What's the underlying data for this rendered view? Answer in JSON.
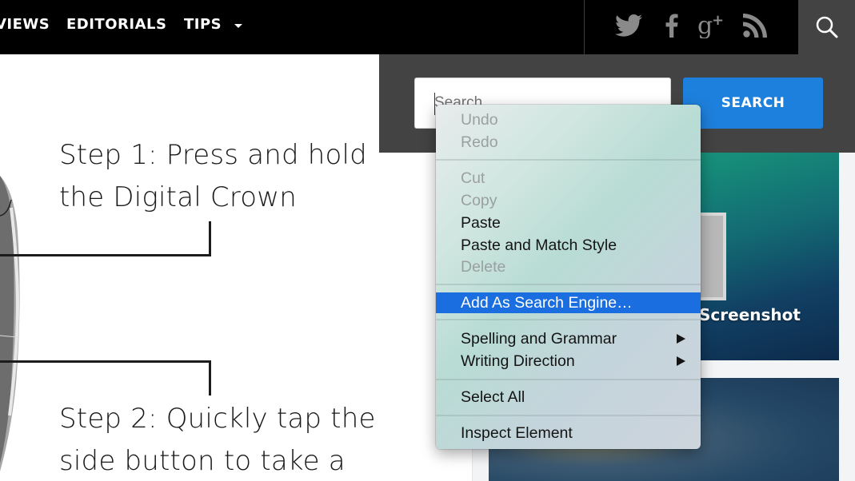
{
  "nav": {
    "items": [
      {
        "label": "VIEWS"
      },
      {
        "label": "EDITORIALS"
      },
      {
        "label": "TIPS"
      }
    ],
    "social": [
      "twitter-icon",
      "facebook-icon",
      "google-plus-icon",
      "rss-icon"
    ],
    "search_toggle_icon": "search-icon"
  },
  "search": {
    "placeholder": "Search",
    "button_label": "SEARCH",
    "button_color": "#1e80dd"
  },
  "article": {
    "step1_line1": "Step 1: Press and hold",
    "step1_line2": "the Digital Crown",
    "step2_line1": "Step 2: Quickly tap the",
    "step2_line2": "side button to take a"
  },
  "sidebar": {
    "thumb1_title": "Screenshot"
  },
  "context_menu": {
    "items": [
      {
        "label": "Undo",
        "enabled": false
      },
      {
        "label": "Redo",
        "enabled": false
      },
      {
        "label": "Cut",
        "enabled": false
      },
      {
        "label": "Copy",
        "enabled": false
      },
      {
        "label": "Paste",
        "enabled": true
      },
      {
        "label": "Paste and Match Style",
        "enabled": true
      },
      {
        "label": "Delete",
        "enabled": false
      },
      {
        "label": "Add As Search Engine…",
        "enabled": true,
        "highlighted": true
      },
      {
        "label": "Spelling and Grammar",
        "enabled": true,
        "submenu": true
      },
      {
        "label": "Writing Direction",
        "enabled": true,
        "submenu": true
      },
      {
        "label": "Select All",
        "enabled": true
      },
      {
        "label": "Inspect Element",
        "enabled": true
      }
    ],
    "highlight_color": "#1a6ee0"
  }
}
